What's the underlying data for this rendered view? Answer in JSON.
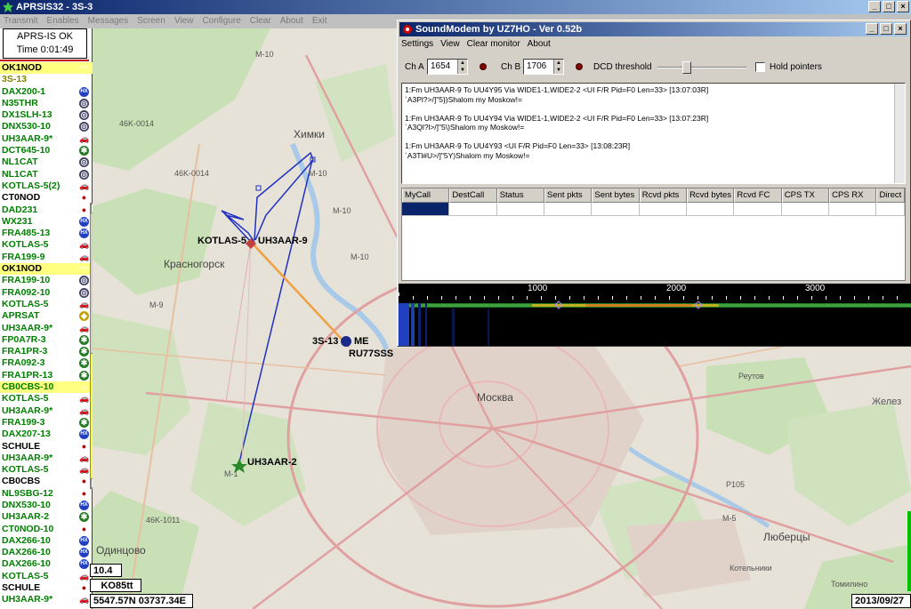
{
  "main_window": {
    "title": "APRSIS32 - 3S-3",
    "menu": [
      "Transmit",
      "Enables",
      "Messages",
      "Screen",
      "View",
      "Configure",
      "Clear",
      "About",
      "Exit"
    ]
  },
  "status": {
    "line1": "APRS-IS OK",
    "line2": "Time 0:01:49"
  },
  "stations": [
    {
      "name": "OK1NOD",
      "color": "#000000",
      "bg": "#ffff80",
      "icon": "wave-icon"
    },
    {
      "name": "3S-13",
      "color": "#808000",
      "bg": "",
      "icon": ""
    },
    {
      "name": "DAX200-1",
      "color": "#008000",
      "bg": "",
      "icon": "hx-icon"
    },
    {
      "name": "N35THR",
      "color": "#008000",
      "bg": "",
      "icon": "target-icon"
    },
    {
      "name": "DX1SLH-13",
      "color": "#008000",
      "bg": "",
      "icon": "target-icon"
    },
    {
      "name": "DNX530-10",
      "color": "#008000",
      "bg": "",
      "icon": "target-icon"
    },
    {
      "name": "UH3AAR-9*",
      "color": "#008000",
      "bg": "",
      "icon": "car-icon"
    },
    {
      "name": "DCT645-10",
      "color": "#008000",
      "bg": "",
      "icon": "star-icon"
    },
    {
      "name": "NL1CAT",
      "color": "#008000",
      "bg": "",
      "icon": "target-icon"
    },
    {
      "name": "NL1CAT",
      "color": "#008000",
      "bg": "",
      "icon": "target-icon"
    },
    {
      "name": "KOTLAS-5(2)",
      "color": "#008000",
      "bg": "",
      "icon": "car-icon"
    },
    {
      "name": "CT0NOD",
      "color": "#000000",
      "bg": "",
      "icon": "dot-icon"
    },
    {
      "name": "DAD231",
      "color": "#008000",
      "bg": "",
      "icon": "dot-icon"
    },
    {
      "name": "WX231",
      "color": "#008000",
      "bg": "",
      "icon": "hx-icon"
    },
    {
      "name": "FRA485-13",
      "color": "#008000",
      "bg": "",
      "icon": "hx-icon"
    },
    {
      "name": "KOTLAS-5",
      "color": "#008000",
      "bg": "",
      "icon": "car-icon"
    },
    {
      "name": "FRA199-9",
      "color": "#008000",
      "bg": "",
      "icon": "car-icon"
    },
    {
      "name": "OK1NOD",
      "color": "#000000",
      "bg": "#ffff80",
      "icon": "wave-icon"
    },
    {
      "name": "FRA199-10",
      "color": "#008000",
      "bg": "",
      "icon": "target-icon"
    },
    {
      "name": "FRA092-10",
      "color": "#008000",
      "bg": "",
      "icon": "target-icon"
    },
    {
      "name": "KOTLAS-5",
      "color": "#008000",
      "bg": "",
      "icon": "car-icon"
    },
    {
      "name": "APRSAT",
      "color": "#008000",
      "bg": "",
      "icon": "diamond-icon"
    },
    {
      "name": "UH3AAR-9*",
      "color": "#008000",
      "bg": "",
      "icon": "car-icon"
    },
    {
      "name": "FP0A7R-3",
      "color": "#008000",
      "bg": "",
      "icon": "star-icon"
    },
    {
      "name": "FRA1PR-3",
      "color": "#008000",
      "bg": "",
      "icon": "star-icon"
    },
    {
      "name": "FRA092-3",
      "color": "#008000",
      "bg": "",
      "icon": "star-icon"
    },
    {
      "name": "FRA1PR-13",
      "color": "#008000",
      "bg": "",
      "icon": "star-icon"
    },
    {
      "name": "CB0CBS-10",
      "color": "#008000",
      "bg": "#ffff80",
      "icon": "house-icon"
    },
    {
      "name": "KOTLAS-5",
      "color": "#008000",
      "bg": "",
      "icon": "car-icon"
    },
    {
      "name": "UH3AAR-9*",
      "color": "#008000",
      "bg": "",
      "icon": "car-icon"
    },
    {
      "name": "FRA199-3",
      "color": "#008000",
      "bg": "",
      "icon": "star-icon"
    },
    {
      "name": "DAX207-13",
      "color": "#008000",
      "bg": "",
      "icon": "hx-icon"
    },
    {
      "name": "SCHULE",
      "color": "#000000",
      "bg": "",
      "icon": "dot-icon"
    },
    {
      "name": "UH3AAR-9*",
      "color": "#008000",
      "bg": "",
      "icon": "car-icon"
    },
    {
      "name": "KOTLAS-5",
      "color": "#008000",
      "bg": "",
      "icon": "car-icon"
    },
    {
      "name": "CB0CBS",
      "color": "#000000",
      "bg": "",
      "icon": "dot-icon"
    },
    {
      "name": "NL9SBG-12",
      "color": "#008000",
      "bg": "",
      "icon": "dot-icon"
    },
    {
      "name": "DNX530-10",
      "color": "#008000",
      "bg": "",
      "icon": "hx-icon"
    },
    {
      "name": "UH3AAR-2",
      "color": "#008000",
      "bg": "",
      "icon": "star-icon"
    },
    {
      "name": "CT0NOD-10",
      "color": "#008000",
      "bg": "",
      "icon": "dot-icon"
    },
    {
      "name": "DAX266-10",
      "color": "#008000",
      "bg": "",
      "icon": "hx-icon"
    },
    {
      "name": "DAX266-10",
      "color": "#008000",
      "bg": "",
      "icon": "hx-icon"
    },
    {
      "name": "DAX266-10",
      "color": "#008000",
      "bg": "",
      "icon": "hx-icon"
    },
    {
      "name": "KOTLAS-5",
      "color": "#008000",
      "bg": "",
      "icon": "car-icon"
    },
    {
      "name": "SCHULE",
      "color": "#000000",
      "bg": "",
      "icon": "dot-icon"
    },
    {
      "name": "UH3AAR-9*",
      "color": "#008000",
      "bg": "",
      "icon": "car-icon"
    }
  ],
  "map": {
    "labels": {
      "khimki": "Химки",
      "krasnogorsk": "Красногорск",
      "moskva": "Москва",
      "lyubertsy": "Люберцы",
      "odintsovo": "Одинцово",
      "reutov": "Реутов",
      "zhelezno": "Желез",
      "kotelniki": "Котельники",
      "tomilino": "Томилино",
      "m10a": "M-10",
      "m10b": "M-10",
      "m10c": "M-10",
      "m10d": "M-10",
      "m9": "M-9",
      "m1": "M-1",
      "m5": "M-5",
      "p105": "P105",
      "r46k0014a": "46K-0014",
      "r46k0014b": "46K-0014",
      "r46k1011": "46K-1011"
    },
    "callsigns": {
      "kotlas": "KOTLAS-5",
      "uh3aar9": "UH3AAR-9",
      "s3me": "3S-13",
      "me": "ME",
      "ru77sss": "RU77SSS",
      "uh3aar2": "UH3AAR-2"
    }
  },
  "bottom": {
    "scale": "10.4",
    "grid": "KO85tt",
    "coords": "5547.57N 03737.34E",
    "date": "2013/09/27"
  },
  "soundmodem": {
    "title": "SoundModem by UZ7HO - Ver 0.52b",
    "menu": [
      "Settings",
      "View",
      "Clear monitor",
      "About"
    ],
    "cha_label": "Ch A",
    "cha_value": "1654",
    "chb_label": "Ch B",
    "chb_value": "1706",
    "dcd_label": "DCD threshold",
    "hold_label": "Hold pointers",
    "monitor": [
      "1:Fm UH3AAR-9 To UU4Y95 Via WIDE1-1,WIDE2-2 <UI F/R Pid=F0 Len=33> [13:07:03R]",
      "`A3Pl?>/]\"5})Shalom my Moskow!=",
      "",
      "1:Fm UH3AAR-9 To UU4Y94 Via WIDE1-1,WIDE2-2 <UI F/R Pid=F0 Len=33> [13:07:23R]",
      "`A3Ql?l>/]\"5\\)Shalom my Moskow!=",
      "",
      "1:Fm UH3AAR-9 To UU4Y93 <UI F/R Pid=F0 Len=33> [13:08:23R]",
      "`A3Tl#U>/]\"5Y)Shalom my Moskow!="
    ],
    "columns": [
      "MyCall",
      "DestCall",
      "Status",
      "Sent pkts",
      "Sent bytes",
      "Rcvd pkts",
      "Rcvd bytes",
      "Rcvd FC",
      "CPS TX",
      "CPS RX",
      "Direct"
    ],
    "waterfall_ticks": [
      "1000",
      "2000",
      "3000"
    ]
  }
}
